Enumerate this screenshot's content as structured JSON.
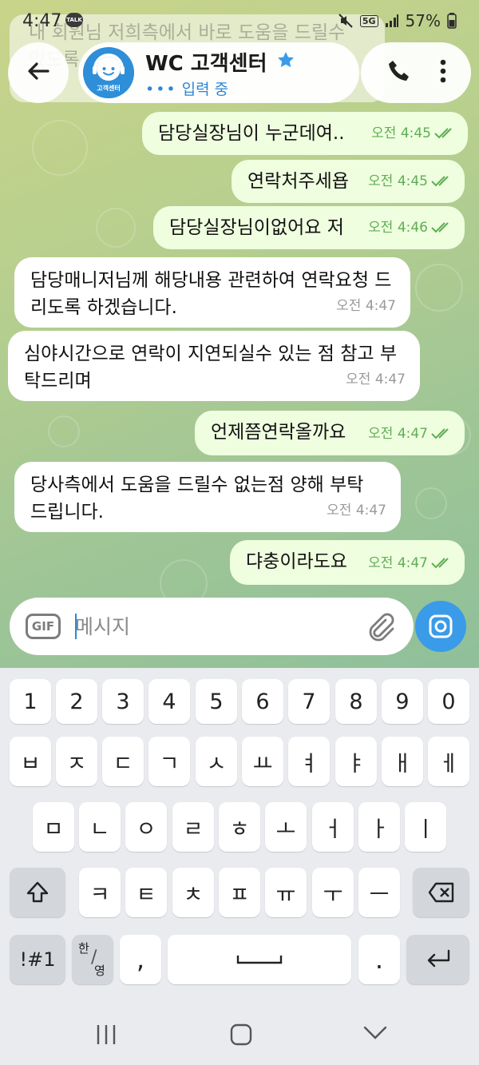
{
  "status_bar": {
    "time": "4:47",
    "talk_badge": "TALK",
    "network": "5G",
    "battery": "57%"
  },
  "background_message_text": "내 회원님 저희측에서 바로 도움을 드릴수 있도록",
  "header": {
    "title": "WC 고객센터",
    "typing_status": "입력 중",
    "avatar_text": "고객센터",
    "verified_color": "#3a9be8"
  },
  "messages": [
    {
      "dir": "out",
      "text": "담당실장님이 누군데여..",
      "time": "오전 4:45"
    },
    {
      "dir": "out",
      "text": "연락처주세욥",
      "time": "오전 4:45"
    },
    {
      "dir": "out",
      "text": "담당실장님이없어요 저",
      "time": "오전 4:46"
    },
    {
      "dir": "in",
      "text": "담당매니저님께 해당내용 관련하여 연락요청 드리도록 하겠습니다.",
      "time": "오전 4:47"
    },
    {
      "dir": "in",
      "text": "심야시간으로 연락이 지연되실수 있는 점 참고 부탁드리며",
      "time": "오전 4:47"
    },
    {
      "dir": "out",
      "text": "언제쯤연락올까요",
      "time": "오전 4:47"
    },
    {
      "dir": "in",
      "text": "당사측에서 도움을 드릴수 없는점 양해 부탁 드립니다.",
      "time": "오전 4:47"
    },
    {
      "dir": "out",
      "text": "댜충이라도요",
      "time": "오전 4:47"
    }
  ],
  "input": {
    "gif_label": "GIF",
    "placeholder": "메시지"
  },
  "keyboard": {
    "row1": [
      "1",
      "2",
      "3",
      "4",
      "5",
      "6",
      "7",
      "8",
      "9",
      "0"
    ],
    "row2": [
      "ㅂ",
      "ㅈ",
      "ㄷ",
      "ㄱ",
      "ㅅ",
      "ㅛ",
      "ㅕ",
      "ㅑ",
      "ㅐ",
      "ㅔ"
    ],
    "row3": [
      "ㅁ",
      "ㄴ",
      "ㅇ",
      "ㄹ",
      "ㅎ",
      "ㅗ",
      "ㅓ",
      "ㅏ",
      "ㅣ"
    ],
    "row4": [
      "ㅋ",
      "ㅌ",
      "ㅊ",
      "ㅍ",
      "ㅠ",
      "ㅜ",
      "ㅡ"
    ],
    "symbols_label": "!#1",
    "lang_top": "한",
    "lang_bottom": "영",
    "comma": ",",
    "period": "."
  }
}
